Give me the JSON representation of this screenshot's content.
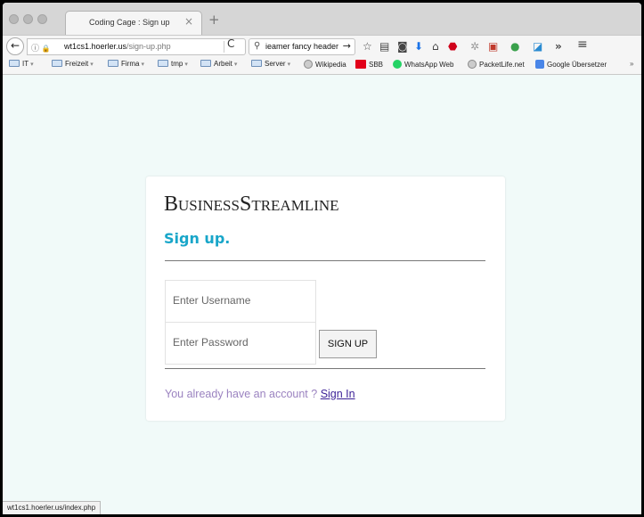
{
  "tab": {
    "title": "Coding Cage : Sign up",
    "close": "×",
    "new_tab": "+"
  },
  "nav": {
    "back": "←",
    "site_info": "ⓘ",
    "url_host": "wt1cs1.hoerler.us",
    "url_path": "/sign-up.php",
    "reload": "C",
    "search_text": "ieamer fancy header",
    "search_go": "→",
    "overflow": "»",
    "menu": "≡"
  },
  "bookmarks": [
    {
      "label": "IT",
      "kind": "folder",
      "caret": true
    },
    {
      "label": "Freizeit",
      "kind": "folder",
      "caret": true
    },
    {
      "label": "Firma",
      "kind": "folder",
      "caret": true
    },
    {
      "label": "tmp",
      "kind": "folder",
      "caret": true
    },
    {
      "label": "Arbeit",
      "kind": "folder",
      "caret": true
    },
    {
      "label": "Server",
      "kind": "folder",
      "caret": true
    },
    {
      "label": "Wikipedia",
      "kind": "site"
    },
    {
      "label": "SBB",
      "kind": "site"
    },
    {
      "label": "WhatsApp Web",
      "kind": "site"
    },
    {
      "label": "PacketLife.net",
      "kind": "site"
    },
    {
      "label": "Google Übersetzer",
      "kind": "site"
    }
  ],
  "bookmarks_overflow": "»",
  "card": {
    "brand": "BusinessStreamline",
    "heading": "Sign up.",
    "username_placeholder": "Enter Username",
    "password_placeholder": "Enter Password",
    "signup_button": "SIGN UP",
    "already_text": "You already have an account ?",
    "signin_link": "Sign In"
  },
  "status": {
    "url": "wt1cs1.hoerler.us/index.php"
  },
  "colors": {
    "page_background": "#f1faf9",
    "heading": "#18a6c9",
    "prompt_text": "#9b83c0",
    "link": "#3b1f96"
  }
}
